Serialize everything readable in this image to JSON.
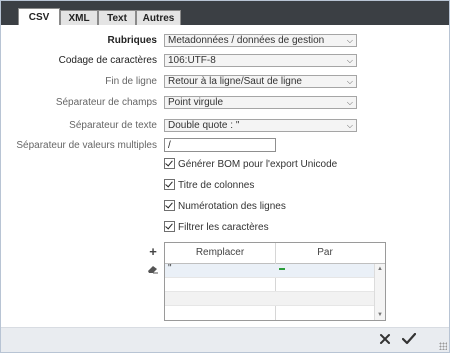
{
  "tabs": [
    {
      "label": "CSV",
      "active": true
    },
    {
      "label": "XML",
      "active": false
    },
    {
      "label": "Text",
      "active": false
    },
    {
      "label": "Autres",
      "active": false
    }
  ],
  "form": {
    "rubriques": {
      "label": "Rubriques",
      "value": "Metadonnées / données de gestion"
    },
    "codage": {
      "label": "Codage de caractères",
      "value": "106:UTF-8"
    },
    "fin_ligne": {
      "label": "Fin de ligne",
      "value": "Retour à la ligne/Saut de ligne"
    },
    "sep_champs": {
      "label": "Séparateur de champs",
      "value": "Point virgule"
    },
    "sep_texte": {
      "label": "Séparateur de texte",
      "value": "Double quote : \""
    },
    "sep_multi": {
      "label": "Séparateur de valeurs multiples",
      "value": "/"
    }
  },
  "checkboxes": [
    {
      "label": "Générer BOM pour l'export Unicode",
      "checked": true
    },
    {
      "label": "Titre de colonnes",
      "checked": true
    },
    {
      "label": "Numérotation des lignes",
      "checked": true
    },
    {
      "label": "Filtrer les caractères",
      "checked": true
    }
  ],
  "filter_table": {
    "columns": [
      "Remplacer",
      "Par"
    ],
    "rows": [
      {
        "remplacer": "\"",
        "par_color": "#2a9d3a"
      }
    ]
  },
  "side_buttons": {
    "add": "+",
    "remove_icon": "eraser-icon"
  },
  "footer": {
    "cancel_icon": "close-icon",
    "ok_icon": "check-icon"
  }
}
